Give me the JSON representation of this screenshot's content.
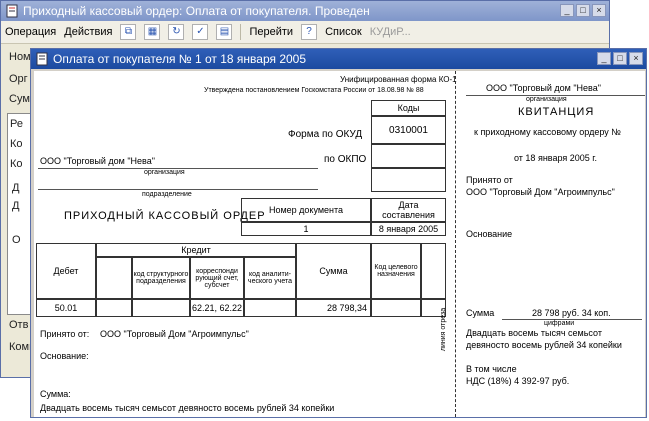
{
  "back_window": {
    "title": "Приходный кассовый ордер: Оплата от покупателя. Проведен",
    "toolbar": {
      "operation": "Операция",
      "actions": "Действия",
      "goto": "Перейти",
      "help": "?",
      "list": "Список",
      "kudir": "КУДиР..."
    },
    "side_labels": [
      "Ном",
      "Орг",
      "Сумм",
      "Ре",
      "Ко",
      "Ко",
      "Д",
      "Д",
      "О",
      "Отв",
      "Комм"
    ]
  },
  "front_window": {
    "title": "Оплата от покупателя № 1 от 18 января 2005",
    "form": {
      "unified_form": "Унифицированная форма КО-1",
      "approved": "Утверждена постановлением Госкомстата России от 18.08.98 № 88",
      "codes_header": "Коды",
      "okud_label": "Форма по ОКУД",
      "okud_code": "0310001",
      "okpo_label": "по ОКПО",
      "organization": "ООО \"Торговый дом \"Нева\"",
      "organization_caption": "организация",
      "department_caption": "подразделение",
      "doc_title": "ПРИХОДНЫЙ КАССОВЫЙ ОРДЕР",
      "doc_number_header": "Номер документа",
      "doc_date_header": "Дата составления",
      "doc_number": "1",
      "doc_date": "8 января 2005",
      "table": {
        "debit": "Дебет",
        "credit": "Кредит",
        "col_code_dept": "код структурного подразделения",
        "col_corr_account": "корреспонди рующий счет, субсчет",
        "col_analytic": "код аналити- ческого учета",
        "col_sum": "Сумма",
        "col_purpose": "Код целевого назначения",
        "row_debit": "50.01",
        "row_corr": "62.21, 62.22",
        "row_sum": "28 798,34"
      },
      "received_from_label": "Принято от:",
      "received_from": "ООО \"Торговый Дом \"Агроимпульс\"",
      "basis_label": "Основание:",
      "sum_label": "Сумма:",
      "sum_words": "Двадцать восемь тысяч семьсот девяносто восемь рублей 34 копейки"
    },
    "receipt": {
      "organization": "ООО \"Торговый дом \"Нева\"",
      "organization_caption": "организация",
      "title": "КВИТАНЦИЯ",
      "to_order": "к приходному кассовому ордеру №",
      "date": "от 18 января 2005 г.",
      "received_from_label": "Принято от",
      "received_from": "ООО \"Торговый Дом \"Агроимпульс\"",
      "basis_label": "Основание",
      "sum_label": "Сумма",
      "sum_figures": "28 798 руб. 34 коп.",
      "sum_caption": "цифрами",
      "sum_words_1": "Двадцать восемь тысяч семьсот",
      "sum_words_2": "девяносто восемь рублей 34 копейки",
      "including_label": "В том числе",
      "vat": "НДС (18%) 4 392-97 руб.",
      "cut_line": "линия отреза"
    }
  }
}
